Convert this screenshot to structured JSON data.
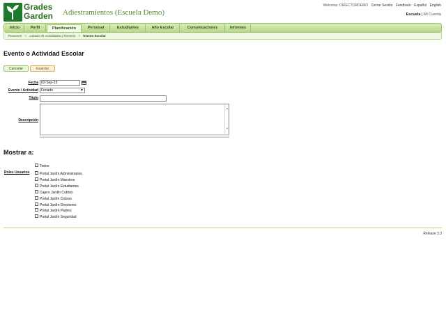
{
  "brand": {
    "logo_text": "Grades Garden",
    "logo_line1": "Grades",
    "logo_line2": "Garden",
    "school_title": "Adiestramientos (Escuela Demo)",
    "accent": "#2c6e1f",
    "logo_icon": "leaf-icon"
  },
  "toplinks": {
    "welcome": "Welcome: DIRECTORDEMO",
    "logout": "Cerrar Sesión",
    "feedback": "Feedback",
    "spanish": "Español",
    "english": "English"
  },
  "context": {
    "school": "Escuela",
    "sep": "|",
    "account": "Mi Cuenta"
  },
  "nav": {
    "items": [
      {
        "label": "Inicio"
      },
      {
        "label": "Perfil"
      },
      {
        "label": "Planificación"
      },
      {
        "label": "Personal"
      },
      {
        "label": "Estudiantes"
      },
      {
        "label": "Año Escolar"
      },
      {
        "label": "Comunicaciones"
      },
      {
        "label": "Informes"
      }
    ],
    "active": "Planificación"
  },
  "breadcrumb": {
    "items": [
      "Resumen",
      "Listado de Actividades y Eventos",
      "Evento Escolar"
    ],
    "sep": ">"
  },
  "page": {
    "title": "Evento o Actividad Escolar",
    "cancel_label": "Cancelar",
    "save_label": "Guardar"
  },
  "form": {
    "date_label": "Fecha",
    "date_value": "02-Sep-19",
    "event_label": "Evento / Actividad",
    "event_value": "Feriado",
    "title_label": "Título",
    "title_value": "",
    "desc_label": "Descripción",
    "desc_value": ""
  },
  "show_to": {
    "title": "Mostrar a:",
    "roles_label": "Roles Usuarios",
    "options": [
      {
        "label": "Todos"
      },
      {
        "label": "Portal Jardín Administrativo"
      },
      {
        "label": "Portal Jardín Maestros"
      },
      {
        "label": "Portal Jardín Estudiantes"
      },
      {
        "label": "Cajero Jardín Cobros"
      },
      {
        "label": "Portal Jardín Cobros"
      },
      {
        "label": "Portal Jardín Directores"
      },
      {
        "label": "Portal Jardín Padres"
      },
      {
        "label": "Portal Jardín Seguridad"
      }
    ]
  },
  "footer": {
    "release": "Release 3.3"
  }
}
